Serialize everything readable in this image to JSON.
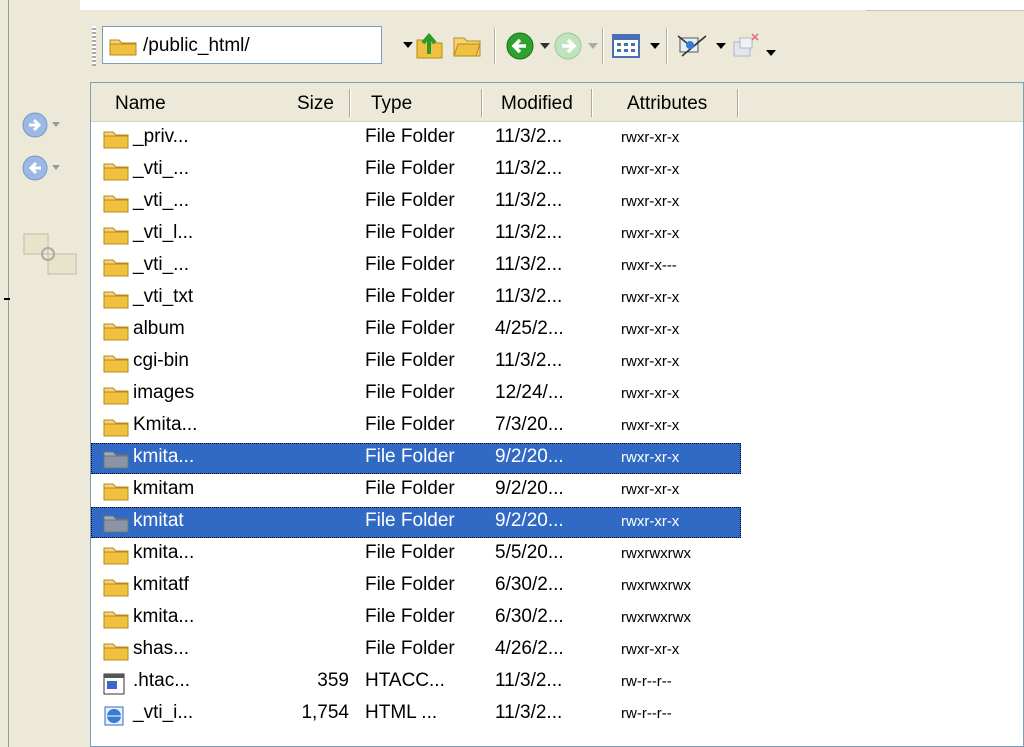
{
  "toolbar": {
    "path": "/public_html/",
    "icons": [
      "folder-icon",
      "dropdown-arrow-icon",
      "up-folder-icon",
      "open-folder-icon",
      "back-icon",
      "forward-icon",
      "view-mode-icon",
      "filter-icon",
      "settings-icon"
    ]
  },
  "columns": [
    "Name",
    "Size",
    "Type",
    "Modified",
    "Attributes"
  ],
  "rows": [
    {
      "name": "_priv...",
      "size": "",
      "type": "File Folder",
      "modified": "11/3/2...",
      "attributes": "rwxr-xr-x",
      "selected": false,
      "icon": "folder-icon"
    },
    {
      "name": "_vti_...",
      "size": "",
      "type": "File Folder",
      "modified": "11/3/2...",
      "attributes": "rwxr-xr-x",
      "selected": false,
      "icon": "folder-icon"
    },
    {
      "name": "_vti_...",
      "size": "",
      "type": "File Folder",
      "modified": "11/3/2...",
      "attributes": "rwxr-xr-x",
      "selected": false,
      "icon": "folder-icon"
    },
    {
      "name": "_vti_l...",
      "size": "",
      "type": "File Folder",
      "modified": "11/3/2...",
      "attributes": "rwxr-xr-x",
      "selected": false,
      "icon": "folder-icon"
    },
    {
      "name": "_vti_...",
      "size": "",
      "type": "File Folder",
      "modified": "11/3/2...",
      "attributes": "rwxr-x---",
      "selected": false,
      "icon": "folder-icon"
    },
    {
      "name": "_vti_txt",
      "size": "",
      "type": "File Folder",
      "modified": "11/3/2...",
      "attributes": "rwxr-xr-x",
      "selected": false,
      "icon": "folder-icon"
    },
    {
      "name": "album",
      "size": "",
      "type": "File Folder",
      "modified": "4/25/2...",
      "attributes": "rwxr-xr-x",
      "selected": false,
      "icon": "folder-icon"
    },
    {
      "name": "cgi-bin",
      "size": "",
      "type": "File Folder",
      "modified": "11/3/2...",
      "attributes": "rwxr-xr-x",
      "selected": false,
      "icon": "folder-icon"
    },
    {
      "name": "images",
      "size": "",
      "type": "File Folder",
      "modified": "12/24/...",
      "attributes": "rwxr-xr-x",
      "selected": false,
      "icon": "folder-icon"
    },
    {
      "name": "Kmita...",
      "size": "",
      "type": "File Folder",
      "modified": "7/3/20...",
      "attributes": "rwxr-xr-x",
      "selected": false,
      "icon": "folder-icon"
    },
    {
      "name": "kmita...",
      "size": "",
      "type": "File Folder",
      "modified": "9/2/20...",
      "attributes": "rwxr-xr-x",
      "selected": true,
      "icon": "folder-icon"
    },
    {
      "name": "kmitam",
      "size": "",
      "type": "File Folder",
      "modified": "9/2/20...",
      "attributes": "rwxr-xr-x",
      "selected": false,
      "icon": "folder-icon"
    },
    {
      "name": "kmitat",
      "size": "",
      "type": "File Folder",
      "modified": "9/2/20...",
      "attributes": "rwxr-xr-x",
      "selected": true,
      "icon": "folder-icon"
    },
    {
      "name": "kmita...",
      "size": "",
      "type": "File Folder",
      "modified": "5/5/20...",
      "attributes": "rwxrwxrwx",
      "selected": false,
      "icon": "folder-icon"
    },
    {
      "name": "kmitatf",
      "size": "",
      "type": "File Folder",
      "modified": "6/30/2...",
      "attributes": "rwxrwxrwx",
      "selected": false,
      "icon": "folder-icon"
    },
    {
      "name": "kmita...",
      "size": "",
      "type": "File Folder",
      "modified": "6/30/2...",
      "attributes": "rwxrwxrwx",
      "selected": false,
      "icon": "folder-icon"
    },
    {
      "name": "shas...",
      "size": "",
      "type": "File Folder",
      "modified": "4/26/2...",
      "attributes": "rwxr-xr-x",
      "selected": false,
      "icon": "folder-icon"
    },
    {
      "name": ".htac...",
      "size": "359",
      "type": "HTACC...",
      "modified": "11/3/2...",
      "attributes": "rw-r--r--",
      "selected": false,
      "icon": "htaccess-file-icon"
    },
    {
      "name": "_vti_i...",
      "size": "1,754",
      "type": "HTML ...",
      "modified": "11/3/2...",
      "attributes": "rw-r--r--",
      "selected": false,
      "icon": "html-file-icon"
    }
  ],
  "colors": {
    "selection": "#316ac5",
    "folder": "#f0c040",
    "background": "#ece9d8"
  }
}
